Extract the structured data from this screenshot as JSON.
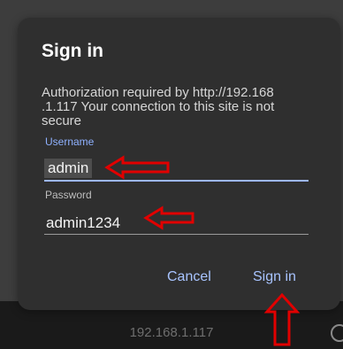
{
  "dialog": {
    "title": "Sign in",
    "message": "Authorization required by http://192.168\n.1.117 Your connection to this site is not secure",
    "username": {
      "label": "Username",
      "value": "admin"
    },
    "password": {
      "label": "Password",
      "value": "admin1234"
    },
    "cancel_label": "Cancel",
    "signin_label": "Sign in"
  },
  "browser": {
    "url": "192.168.1.117"
  },
  "colors": {
    "accent": "#a8c4ff",
    "annotation_arrow": "#e10000"
  }
}
